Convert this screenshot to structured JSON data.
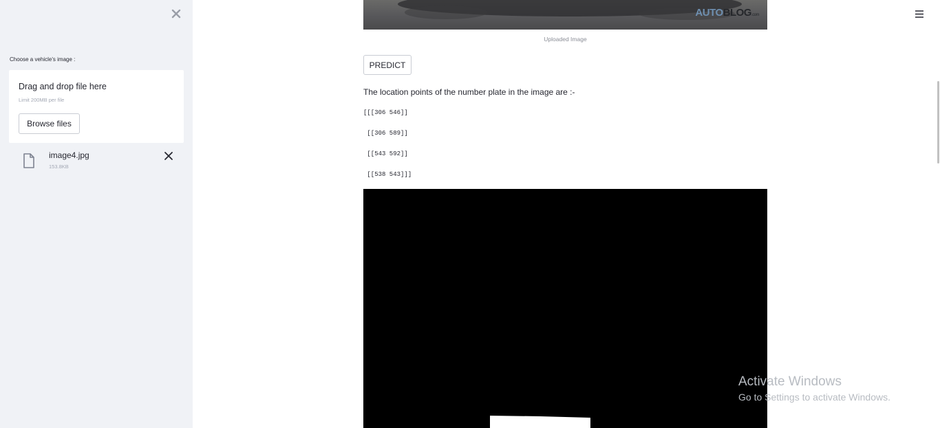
{
  "sidebar": {
    "uploader_label": "Choose a vehicle's image :",
    "dropzone_title": "Drag and drop file here",
    "dropzone_limit": "Limit 200MB per file",
    "browse_label": "Browse files",
    "file": {
      "name": "image4.jpg",
      "size": "153.8KB"
    }
  },
  "main": {
    "uploaded_image": {
      "caption": "Uploaded Image",
      "logo_auto": "AUTO",
      "logo_blog": "BLOG",
      "logo_suffix": ".com"
    },
    "predict_label": "PREDICT",
    "location_text": "The location points of the number plate in the image are :-",
    "points": [
      "[[[306 546]]",
      " [[306 589]]",
      " [[543 592]]",
      " [[538 543]]]"
    ]
  },
  "watermark": {
    "title": "Activate Windows",
    "subtitle": "Go to Settings to activate Windows."
  },
  "icons": {
    "close": "close-icon",
    "file": "file-icon",
    "remove": "remove-file-icon",
    "menu": "hamburger-menu-icon"
  }
}
